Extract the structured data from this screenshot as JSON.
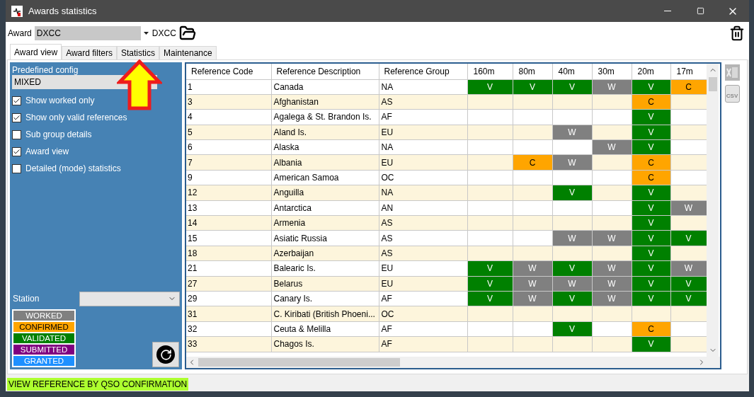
{
  "window": {
    "title": "Awards statistics"
  },
  "toolbar": {
    "award_label": "Award",
    "award_value": "DXCC",
    "award_name": "DXCC"
  },
  "tabs": [
    {
      "label": "Award view",
      "selected": true
    },
    {
      "label": "Award filters",
      "selected": false
    },
    {
      "label": "Statistics",
      "selected": false
    },
    {
      "label": "Maintenance",
      "selected": false
    }
  ],
  "options": {
    "config_label": "Predefined config",
    "config_value": "MIXED",
    "checkboxes": [
      {
        "label": "Show worked only",
        "checked": true
      },
      {
        "label": "Show only valid references",
        "checked": true
      },
      {
        "label": "Sub group details",
        "checked": false
      },
      {
        "label": "Award view",
        "checked": true
      },
      {
        "label": "Detailed (mode) statistics",
        "checked": false
      }
    ],
    "station_label": "Station"
  },
  "legend": [
    {
      "label": "WORKED",
      "color": "#808080"
    },
    {
      "label": "CONFIRMED",
      "color": "#ffa500"
    },
    {
      "label": "VALIDATED",
      "color": "#008000"
    },
    {
      "label": "SUBMITTED",
      "color": "#800080"
    },
    {
      "label": "GRANTED",
      "color": "#1e90ff"
    }
  ],
  "table": {
    "columns": [
      "Reference Code",
      "Reference Description",
      "Reference Group",
      "160m",
      "80m",
      "40m",
      "30m",
      "20m",
      "17m"
    ],
    "rows": [
      {
        "code": "1",
        "description": "Canada",
        "group": "NA",
        "bands": [
          {
            "text": "V",
            "kind": "validated"
          },
          {
            "text": "V",
            "kind": "validated"
          },
          {
            "text": "V",
            "kind": "validated"
          },
          {
            "text": "W",
            "kind": "worked"
          },
          {
            "text": "V",
            "kind": "validated"
          },
          {
            "text": "C",
            "kind": "confirmed"
          }
        ]
      },
      {
        "code": "3",
        "description": "Afghanistan",
        "group": "AS",
        "bands": [
          {
            "kind": "empty"
          },
          {
            "kind": "empty"
          },
          {
            "kind": "empty"
          },
          {
            "kind": "empty"
          },
          {
            "text": "C",
            "kind": "confirmed"
          },
          {
            "kind": "empty"
          }
        ]
      },
      {
        "code": "4",
        "description": "Agalega & St. Brandon Is.",
        "group": "AF",
        "bands": [
          {
            "kind": "empty"
          },
          {
            "kind": "empty"
          },
          {
            "kind": "empty"
          },
          {
            "kind": "empty"
          },
          {
            "text": "V",
            "kind": "validated"
          },
          {
            "kind": "empty"
          }
        ]
      },
      {
        "code": "5",
        "description": "Aland Is.",
        "group": "EU",
        "bands": [
          {
            "kind": "empty"
          },
          {
            "kind": "empty"
          },
          {
            "text": "W",
            "kind": "worked"
          },
          {
            "kind": "empty"
          },
          {
            "text": "V",
            "kind": "validated"
          },
          {
            "kind": "empty"
          }
        ]
      },
      {
        "code": "6",
        "description": "Alaska",
        "group": "NA",
        "bands": [
          {
            "kind": "empty"
          },
          {
            "kind": "empty"
          },
          {
            "kind": "empty"
          },
          {
            "text": "W",
            "kind": "worked"
          },
          {
            "text": "V",
            "kind": "validated"
          },
          {
            "kind": "empty"
          }
        ]
      },
      {
        "code": "7",
        "description": "Albania",
        "group": "EU",
        "bands": [
          {
            "kind": "empty"
          },
          {
            "text": "C",
            "kind": "confirmed"
          },
          {
            "text": "W",
            "kind": "worked"
          },
          {
            "kind": "empty"
          },
          {
            "text": "C",
            "kind": "confirmed"
          },
          {
            "kind": "empty"
          }
        ]
      },
      {
        "code": "9",
        "description": "American Samoa",
        "group": "OC",
        "bands": [
          {
            "kind": "empty"
          },
          {
            "kind": "empty"
          },
          {
            "kind": "empty"
          },
          {
            "kind": "empty"
          },
          {
            "text": "C",
            "kind": "confirmed"
          },
          {
            "kind": "empty"
          }
        ]
      },
      {
        "code": "12",
        "description": "Anguilla",
        "group": "NA",
        "bands": [
          {
            "kind": "empty"
          },
          {
            "kind": "empty"
          },
          {
            "text": "V",
            "kind": "validated"
          },
          {
            "kind": "empty"
          },
          {
            "text": "V",
            "kind": "validated"
          },
          {
            "kind": "empty"
          }
        ]
      },
      {
        "code": "13",
        "description": "Antarctica",
        "group": "AN",
        "bands": [
          {
            "kind": "empty"
          },
          {
            "kind": "empty"
          },
          {
            "kind": "empty"
          },
          {
            "kind": "empty"
          },
          {
            "text": "V",
            "kind": "validated"
          },
          {
            "text": "W",
            "kind": "worked"
          }
        ]
      },
      {
        "code": "14",
        "description": "Armenia",
        "group": "AS",
        "bands": [
          {
            "kind": "empty"
          },
          {
            "kind": "empty"
          },
          {
            "kind": "empty"
          },
          {
            "kind": "empty"
          },
          {
            "text": "V",
            "kind": "validated"
          },
          {
            "kind": "empty"
          }
        ]
      },
      {
        "code": "15",
        "description": "Asiatic Russia",
        "group": "AS",
        "bands": [
          {
            "kind": "empty"
          },
          {
            "kind": "empty"
          },
          {
            "text": "W",
            "kind": "worked"
          },
          {
            "text": "W",
            "kind": "worked"
          },
          {
            "text": "V",
            "kind": "validated"
          },
          {
            "text": "V",
            "kind": "validated"
          }
        ]
      },
      {
        "code": "18",
        "description": "Azerbaijan",
        "group": "AS",
        "bands": [
          {
            "kind": "empty"
          },
          {
            "kind": "empty"
          },
          {
            "kind": "empty"
          },
          {
            "kind": "empty"
          },
          {
            "text": "V",
            "kind": "validated"
          },
          {
            "kind": "empty"
          }
        ]
      },
      {
        "code": "21",
        "description": "Balearic Is.",
        "group": "EU",
        "bands": [
          {
            "text": "V",
            "kind": "validated"
          },
          {
            "text": "W",
            "kind": "worked"
          },
          {
            "text": "V",
            "kind": "validated"
          },
          {
            "text": "W",
            "kind": "worked"
          },
          {
            "text": "V",
            "kind": "validated"
          },
          {
            "text": "W",
            "kind": "worked"
          }
        ]
      },
      {
        "code": "27",
        "description": "Belarus",
        "group": "EU",
        "bands": [
          {
            "text": "V",
            "kind": "validated"
          },
          {
            "text": "W",
            "kind": "worked"
          },
          {
            "text": "W",
            "kind": "worked"
          },
          {
            "text": "W",
            "kind": "worked"
          },
          {
            "text": "V",
            "kind": "validated"
          },
          {
            "text": "V",
            "kind": "validated"
          }
        ]
      },
      {
        "code": "29",
        "description": "Canary Is.",
        "group": "AF",
        "bands": [
          {
            "text": "V",
            "kind": "validated"
          },
          {
            "text": "W",
            "kind": "worked"
          },
          {
            "text": "V",
            "kind": "validated"
          },
          {
            "text": "W",
            "kind": "worked"
          },
          {
            "text": "V",
            "kind": "validated"
          },
          {
            "text": "V",
            "kind": "validated"
          }
        ]
      },
      {
        "code": "31",
        "description": "C. Kiribati (British Phoeni...",
        "group": "OC",
        "bands": [
          {
            "kind": "empty"
          },
          {
            "kind": "empty"
          },
          {
            "kind": "empty"
          },
          {
            "kind": "empty"
          },
          {
            "kind": "empty"
          },
          {
            "kind": "empty"
          }
        ]
      },
      {
        "code": "32",
        "description": "Ceuta & Melilla",
        "group": "AF",
        "bands": [
          {
            "kind": "empty"
          },
          {
            "kind": "empty"
          },
          {
            "text": "V",
            "kind": "validated"
          },
          {
            "kind": "empty"
          },
          {
            "text": "C",
            "kind": "confirmed"
          },
          {
            "kind": "empty"
          }
        ]
      },
      {
        "code": "33",
        "description": "Chagos Is.",
        "group": "AF",
        "bands": [
          {
            "kind": "empty"
          },
          {
            "kind": "empty"
          },
          {
            "kind": "empty"
          },
          {
            "kind": "empty"
          },
          {
            "text": "V",
            "kind": "validated"
          },
          {
            "kind": "empty"
          }
        ]
      }
    ]
  },
  "export": {
    "csv_label": "CSV"
  },
  "status_bar": "VIEW REFERENCE BY QSO CONFIRMATION"
}
